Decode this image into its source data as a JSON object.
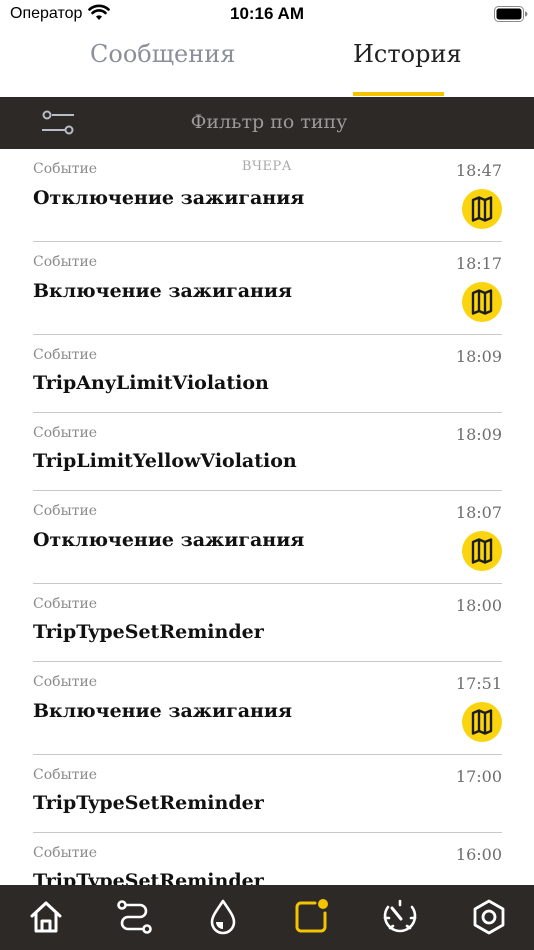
{
  "status_bar": {
    "carrier": "Оператор",
    "time": "10:16 AM"
  },
  "tabs": [
    {
      "label": "Сообщения",
      "active": false
    },
    {
      "label": "История",
      "active": true
    }
  ],
  "filter": {
    "label": "Фильтр по типу"
  },
  "day_label": "ВЧЕРА",
  "events": [
    {
      "type": "Событие",
      "time": "18:47",
      "title": "Отключение зажигания",
      "has_map": true
    },
    {
      "type": "Событие",
      "time": "18:17",
      "title": "Включение зажигания",
      "has_map": true
    },
    {
      "type": "Событие",
      "time": "18:09",
      "title": "TripAnyLimitViolation",
      "has_map": false
    },
    {
      "type": "Событие",
      "time": "18:09",
      "title": "TripLimitYellowViolation",
      "has_map": false
    },
    {
      "type": "Событие",
      "time": "18:07",
      "title": "Отключение зажигания",
      "has_map": true
    },
    {
      "type": "Событие",
      "time": "18:00",
      "title": "TripTypeSetReminder",
      "has_map": false
    },
    {
      "type": "Событие",
      "time": "17:51",
      "title": "Включение зажигания",
      "has_map": true
    },
    {
      "type": "Событие",
      "time": "17:00",
      "title": "TripTypeSetReminder",
      "has_map": false
    },
    {
      "type": "Событие",
      "time": "16:00",
      "title": "TripTypeSetReminder",
      "has_map": false
    }
  ],
  "bottom_nav": [
    {
      "icon": "home-icon",
      "active": false
    },
    {
      "icon": "route-icon",
      "active": false
    },
    {
      "icon": "fuel-drop-icon",
      "active": false
    },
    {
      "icon": "notifications-icon",
      "active": true
    },
    {
      "icon": "speedometer-icon",
      "active": false
    },
    {
      "icon": "settings-nut-icon",
      "active": false
    }
  ],
  "colors": {
    "accent": "#f5c400",
    "dark_bar": "#2c2927",
    "map_button": "#f9d40f",
    "nav_icon": "#ffffff"
  }
}
